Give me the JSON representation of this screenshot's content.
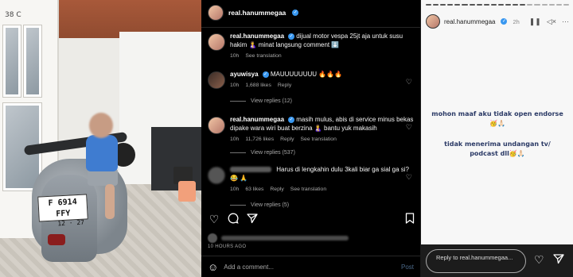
{
  "photo": {
    "house_number": "38 C",
    "plate_number": "F 6914 FFY",
    "plate_date": "12 · 27"
  },
  "post": {
    "username": "real.hanummegaa",
    "caption": {
      "username": "real.hanummegaa",
      "text": "dijual motor vespa 25jt aja untuk susu hakim 🤱 minat langsung comment ⬇️",
      "time": "10h",
      "see_translation": "See translation"
    },
    "comments": [
      {
        "username": "ayuwisya",
        "text": "MAUUUUUUUU 🔥🔥🔥",
        "time": "10h",
        "likes": "1,688 likes",
        "reply": "Reply",
        "view_replies": "View replies (12)"
      },
      {
        "username": "real.hanummegaa",
        "text": "masih mulus, abis di service minus bekas dipake wara wiri buat berzina 🤱 bantu yuk makasih",
        "time": "10h",
        "likes": "11,726 likes",
        "reply": "Reply",
        "see_translation": "See translation",
        "view_replies": "View replies (537)"
      },
      {
        "username": "",
        "text": "Harus di lengkahin dulu 3kali biar ga sial ga si? 😂 🙏",
        "time": "10h",
        "likes": "63 likes",
        "reply": "Reply",
        "see_translation": "See translation",
        "view_replies": "View replies (5)"
      }
    ],
    "time_ago": "10 HOURS AGO",
    "add_comment_placeholder": "Add a comment...",
    "post_label": "Post"
  },
  "story": {
    "username": "real.hanummegaa",
    "time": "2h",
    "line1": "mohon maaf aku tidak open endorse🥳🙏🏻",
    "line2": "tidak menerima undangan tv/ podcast dll🥳🙏🏻",
    "reply_placeholder": "Reply to real.hanummegaa..."
  },
  "icons": {
    "heart": "heart-icon",
    "comment": "comment-icon",
    "share": "send-icon",
    "save": "bookmark-icon",
    "emoji": "smile-icon"
  },
  "colors": {
    "verified_blue": "#3897f0",
    "story_text": "#2b3a66"
  }
}
